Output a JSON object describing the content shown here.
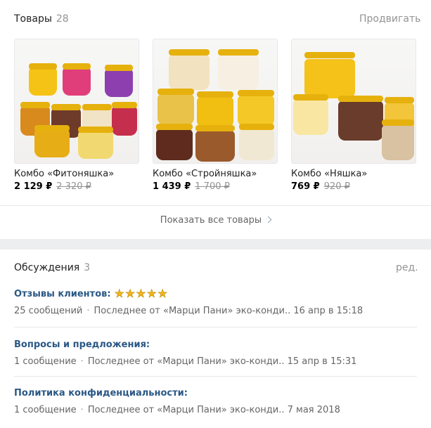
{
  "goods": {
    "title": "Товары",
    "count": "28",
    "promote": "Продвигать",
    "items": [
      {
        "name": "Комбо «Фитоняшка»",
        "price": "2 129 ₽",
        "old_price": "2 320 ₽"
      },
      {
        "name": "Комбо «Стройняшка»",
        "price": "1 439 ₽",
        "old_price": "1 700 ₽"
      },
      {
        "name": "Комбо «Няшка»",
        "price": "769 ₽",
        "old_price": "920 ₽"
      }
    ],
    "show_all": "Показать все товары"
  },
  "discussions": {
    "title": "Обсуждения",
    "count": "3",
    "edit": "ред.",
    "topics": [
      {
        "title": "Отзывы клиентов:",
        "stars": 5,
        "messages": "25 сообщений",
        "last": "Последнее от «Марци Пани» эко-конди.. 16 апр в 15:18"
      },
      {
        "title": "Вопросы и предложения:",
        "messages": "1 сообщение",
        "last": "Последнее от «Марци Пани» эко-конди.. 15 апр в 15:31"
      },
      {
        "title": "Политика конфиденциальности:",
        "messages": "1 сообщение",
        "last": "Последнее от «Марци Пани» эко-конди.. 7 мая 2018"
      }
    ]
  },
  "colors": {
    "link": "#2a5885",
    "muted": "#939393",
    "star": "#f3b41b"
  }
}
